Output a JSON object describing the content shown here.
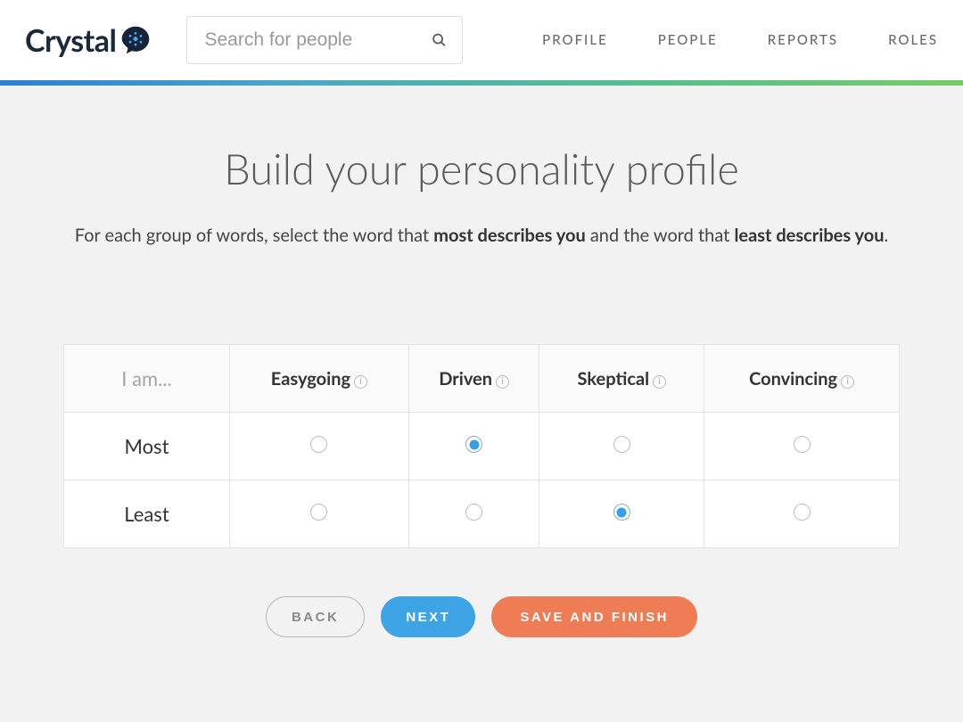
{
  "brand": {
    "name": "Crystal"
  },
  "search": {
    "placeholder": "Search for people"
  },
  "nav": {
    "items": [
      {
        "label": "PROFILE"
      },
      {
        "label": "PEOPLE"
      },
      {
        "label": "REPORTS"
      },
      {
        "label": "ROLES"
      }
    ]
  },
  "page": {
    "title": "Build your personality profile",
    "subtitle_prefix": "For each group of words, select the word that ",
    "subtitle_strong1": "most describes you",
    "subtitle_mid": " and the word that ",
    "subtitle_strong2": "least describes you",
    "subtitle_suffix": "."
  },
  "quiz": {
    "corner_label": "I am...",
    "words": [
      "Easygoing",
      "Driven",
      "Skeptical",
      "Convincing"
    ],
    "rows": [
      {
        "label": "Most",
        "selected_index": 1
      },
      {
        "label": "Least",
        "selected_index": 2
      }
    ],
    "info_char": "i"
  },
  "buttons": {
    "back": "BACK",
    "next": "NEXT",
    "save": "SAVE AND FINISH"
  }
}
